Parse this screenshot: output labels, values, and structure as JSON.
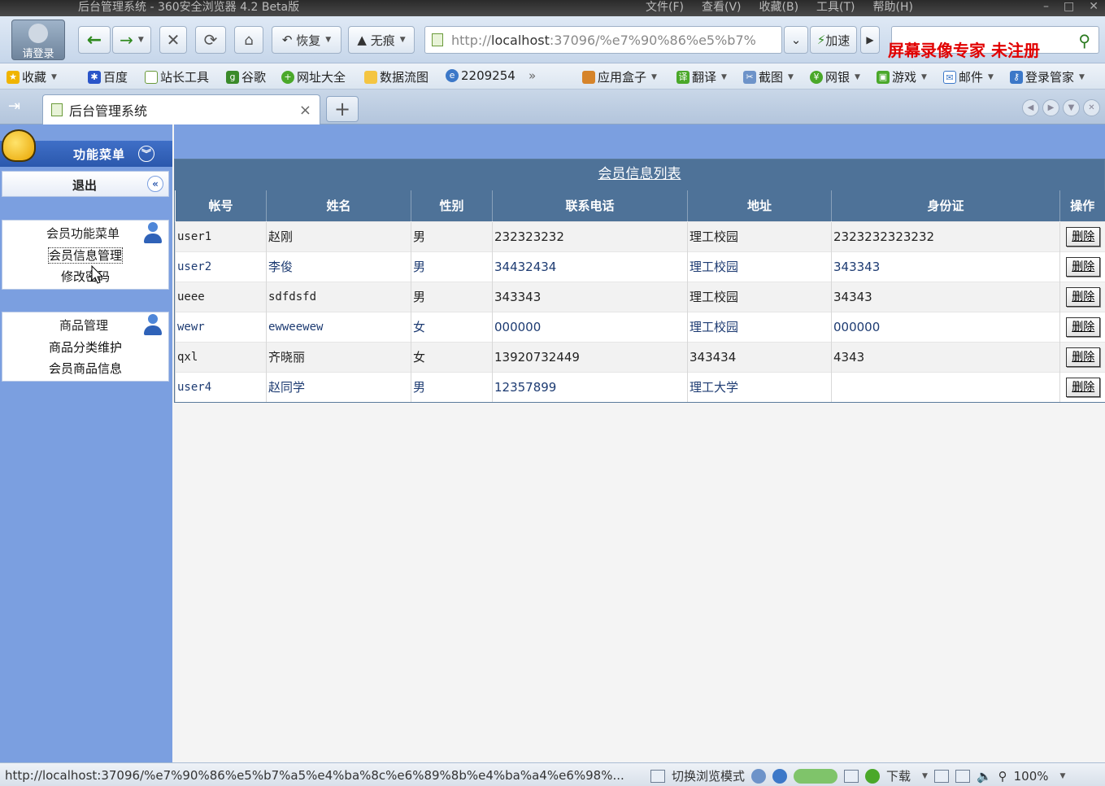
{
  "window": {
    "title": "后台管理系统 - 360安全浏览器 4.2 Beta版",
    "menus": [
      "文件(F)",
      "查看(V)",
      "收藏(B)",
      "工具(T)",
      "帮助(H)"
    ]
  },
  "toolbar": {
    "login_label": "请登录",
    "restore_label": "恢复",
    "private_label": "无痕",
    "address_prefix": "http://",
    "address_host": "localhost",
    "address_rest": ":37096/%e7%90%86%e5%b7%",
    "speedup_label": "加速",
    "watermark": "屏幕录像专家  未注册"
  },
  "bookmarks": {
    "left": [
      "收藏",
      "百度",
      "站长工具",
      "谷歌",
      "网址大全",
      "数据流图",
      "2209254"
    ],
    "more": "»",
    "right": [
      "应用盒子",
      "翻译",
      "截图",
      "网银",
      "游戏",
      "邮件",
      "登录管家"
    ]
  },
  "tab": {
    "title": "后台管理系统",
    "close": "×",
    "new": "+"
  },
  "sidebar": {
    "header": "功能菜单",
    "logout": "退出",
    "groups": [
      {
        "title": "会员功能菜单",
        "items": [
          "会员信息管理",
          "修改密码"
        ]
      },
      {
        "title": "商品管理",
        "items": [
          "商品分类维护",
          "会员商品信息"
        ]
      }
    ]
  },
  "member_table": {
    "caption": "会员信息列表",
    "headers": [
      "帐号",
      "姓名",
      "性别",
      "联系电话",
      "地址",
      "身份证",
      "操作"
    ],
    "delete_label": "删除",
    "rows": [
      [
        "user1",
        "赵刚",
        "男",
        "232323232",
        "理工校园",
        "2323232323232"
      ],
      [
        "user2",
        "李俊",
        "男",
        "34432434",
        "理工校园",
        "343343"
      ],
      [
        "ueee",
        "sdfdsfd",
        "男",
        "343343",
        "理工校园",
        "34343"
      ],
      [
        "wewr",
        "ewweewew",
        "女",
        "000000",
        "理工校园",
        "000000"
      ],
      [
        "qxl",
        "齐晓丽",
        "女",
        "13920732449",
        "343434",
        "4343"
      ],
      [
        "user4",
        "赵同学",
        "男",
        "12357899",
        "理工大学",
        ""
      ]
    ]
  },
  "statusbar": {
    "url": "http://localhost:37096/%e7%90%86%e5%b7%a5%e4%ba%8c%e6%89%8b%e4%ba%a4%e6%98%...",
    "mode": "切换浏览模式",
    "download": "下载",
    "zoom": "100%"
  }
}
